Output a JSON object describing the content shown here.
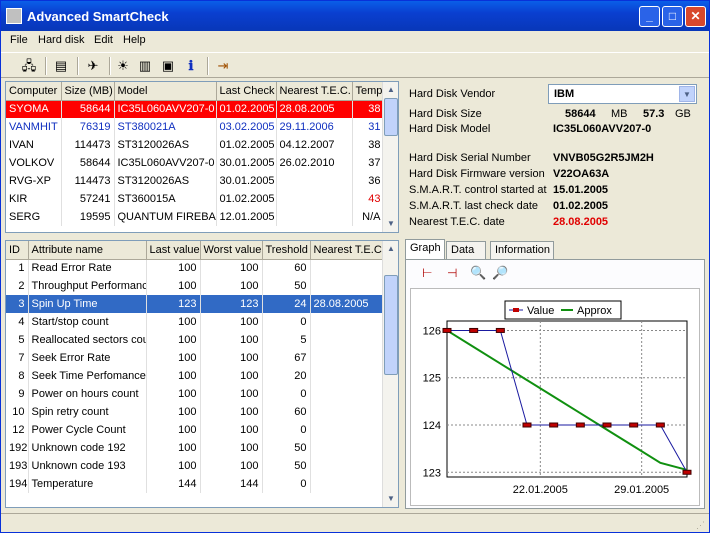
{
  "window": {
    "title": "Advanced SmartCheck"
  },
  "menu": [
    "File",
    "Hard disk",
    "Edit",
    "Help"
  ],
  "computers": {
    "columns": [
      "Computer",
      "Size (MB)",
      "Model",
      "Last Check",
      "Nearest T.E.C.",
      "Temp"
    ],
    "rows": [
      {
        "computer": "SYOMA",
        "size": "58644",
        "model": "IC35L060AVV207-0",
        "last": "01.02.2005",
        "tec": "28.08.2005",
        "temp": "38",
        "style": "red"
      },
      {
        "computer": "VANMHIT",
        "size": "76319",
        "model": "ST380021A",
        "last": "03.02.2005",
        "tec": "29.11.2006",
        "temp": "31",
        "style": "blue"
      },
      {
        "computer": "IVAN",
        "size": "114473",
        "model": "ST3120026AS",
        "last": "01.02.2005",
        "tec": "04.12.2007",
        "temp": "38",
        "style": ""
      },
      {
        "computer": "VOLKOV",
        "size": "58644",
        "model": "IC35L060AVV207-0",
        "last": "30.01.2005",
        "tec": "26.02.2010",
        "temp": "37",
        "style": ""
      },
      {
        "computer": "RVG-XP",
        "size": "114473",
        "model": "ST3120026AS",
        "last": "30.01.2005",
        "tec": "",
        "temp": "36",
        "style": ""
      },
      {
        "computer": "KIR",
        "size": "57241",
        "model": "ST360015A",
        "last": "01.02.2005",
        "tec": "",
        "temp": "43",
        "style": "redtemp"
      },
      {
        "computer": "SERG",
        "size": "19595",
        "model": "QUANTUM FIREBALL",
        "last": "12.01.2005",
        "tec": "",
        "temp": "N/A",
        "style": ""
      }
    ]
  },
  "attributes": {
    "columns": [
      "ID",
      "Attribute name",
      "Last value",
      "Worst value",
      "Treshold",
      "Nearest T.E.C."
    ],
    "rows": [
      {
        "id": "1",
        "name": "Read Error Rate",
        "last": "100",
        "worst": "100",
        "thr": "60",
        "tec": ""
      },
      {
        "id": "2",
        "name": "Throughput Performance",
        "last": "100",
        "worst": "100",
        "thr": "50",
        "tec": ""
      },
      {
        "id": "3",
        "name": "Spin Up Time",
        "last": "123",
        "worst": "123",
        "thr": "24",
        "tec": "28.08.2005",
        "sel": true
      },
      {
        "id": "4",
        "name": "Start/stop count",
        "last": "100",
        "worst": "100",
        "thr": "0",
        "tec": ""
      },
      {
        "id": "5",
        "name": "Reallocated sectors count",
        "last": "100",
        "worst": "100",
        "thr": "5",
        "tec": ""
      },
      {
        "id": "7",
        "name": "Seek Error Rate",
        "last": "100",
        "worst": "100",
        "thr": "67",
        "tec": ""
      },
      {
        "id": "8",
        "name": "Seek Time Perfomance",
        "last": "100",
        "worst": "100",
        "thr": "20",
        "tec": ""
      },
      {
        "id": "9",
        "name": "Power on hours count",
        "last": "100",
        "worst": "100",
        "thr": "0",
        "tec": ""
      },
      {
        "id": "10",
        "name": "Spin retry count",
        "last": "100",
        "worst": "100",
        "thr": "60",
        "tec": ""
      },
      {
        "id": "12",
        "name": "Power Cycle Count",
        "last": "100",
        "worst": "100",
        "thr": "0",
        "tec": ""
      },
      {
        "id": "192",
        "name": "Unknown code 192",
        "last": "100",
        "worst": "100",
        "thr": "50",
        "tec": ""
      },
      {
        "id": "193",
        "name": "Unknown code 193",
        "last": "100",
        "worst": "100",
        "thr": "50",
        "tec": ""
      },
      {
        "id": "194",
        "name": "Temperature",
        "last": "144",
        "worst": "144",
        "thr": "0",
        "tec": ""
      }
    ]
  },
  "info": {
    "vendor_label": "Hard Disk Vendor",
    "vendor": "IBM",
    "size_label": "Hard Disk Size",
    "size_mb": "58644",
    "mb": "MB",
    "size_gb": "57.3",
    "gb": "GB",
    "model_label": "Hard Disk Model",
    "model": "IC35L060AVV207-0",
    "serial_label": "Hard Disk Serial Number",
    "serial": "VNVB05G2R5JM2H",
    "fw_label": "Hard Disk Firmware version",
    "fw": "V22OA63A",
    "started_label": "S.M.A.R.T. control started at",
    "started": "15.01.2005",
    "lastcheck_label": "S.M.A.R.T. last check date",
    "lastcheck": "01.02.2005",
    "tec_label": "Nearest T.E.C. date",
    "tec": "28.08.2005"
  },
  "tabs": [
    "Graph",
    "Data",
    "Information"
  ],
  "chart_data": {
    "type": "line",
    "x": [
      "15.01.2005",
      "17.01.2005",
      "19.01.2005",
      "21.01.2005",
      "23.01.2005",
      "25.01.2005",
      "27.01.2005",
      "29.01.2005",
      "31.01.2005",
      "01.02.2005"
    ],
    "series": [
      {
        "name": "Value",
        "values": [
          126,
          126,
          126,
          124,
          124,
          124,
          124,
          124,
          124,
          123
        ]
      },
      {
        "name": "Approx",
        "values": [
          126,
          125.65,
          125.3,
          124.95,
          124.6,
          124.25,
          123.9,
          123.55,
          123.2,
          123.05
        ]
      }
    ],
    "xticks": [
      "22.01.2005",
      "29.01.2005"
    ],
    "yticks": [
      123,
      124,
      125,
      126
    ],
    "ylim": [
      122.9,
      126.2
    ],
    "legend": "top",
    "colors": {
      "Value": "#1a1aa0",
      "marker": "#c00000",
      "Approx": "#109010"
    }
  }
}
